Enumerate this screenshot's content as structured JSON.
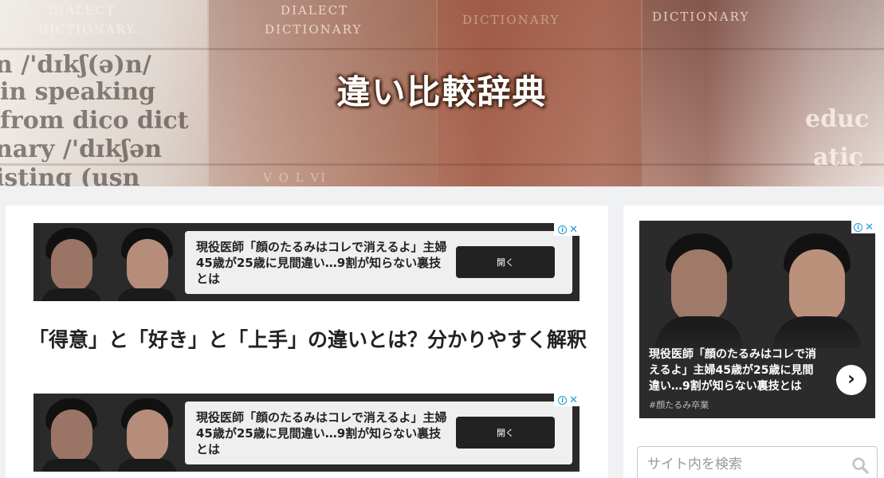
{
  "header": {
    "site_title": "違い比較辞典",
    "background_words": {
      "dialect_1": "DIALECT",
      "dictionary_1": "DICTIONARY.",
      "dialect_2": "DIALECT",
      "dictionary_2": "DICTIONARY",
      "dictionary_3": "DICTIONARY",
      "dictionary_4": "DICTIONARY",
      "phon_1": "n /'dɪkʃ(ə)n/",
      "line_1": "in speaking",
      "line_2": "from dico dict",
      "line_3": "nary /'dɪkʃən",
      "line_4": "isting (usn",
      "vol": "V O L  VI",
      "right_1": "educ",
      "right_2": "atic"
    }
  },
  "ads": {
    "banner_text": "現役医師「顔のたるみはコレで消えるよ」主婦45歳が25歳に見間違い…9割が知らない裏技とは",
    "button_label": "開く",
    "info_glyph": "i",
    "close_glyph": "✕"
  },
  "article": {
    "title": "「得意」と「好き」と「上手」の違いとは？分かりやすく解釈"
  },
  "sidebar": {
    "ad_text": "現役医師「顔のたるみはコレで消えるよ」主婦45歳が25歳に見間違い…9割が知らない裏技とは",
    "ad_tag": "#顔たるみ卒業",
    "ad_next_glyph": "›",
    "search_placeholder": "サイト内を検索"
  },
  "colors": {
    "page_bg": "#f0f1f3",
    "ad_bg": "#2a2a2a",
    "ad_button": "#222222",
    "adchoice_blue": "#1a9bd7"
  }
}
